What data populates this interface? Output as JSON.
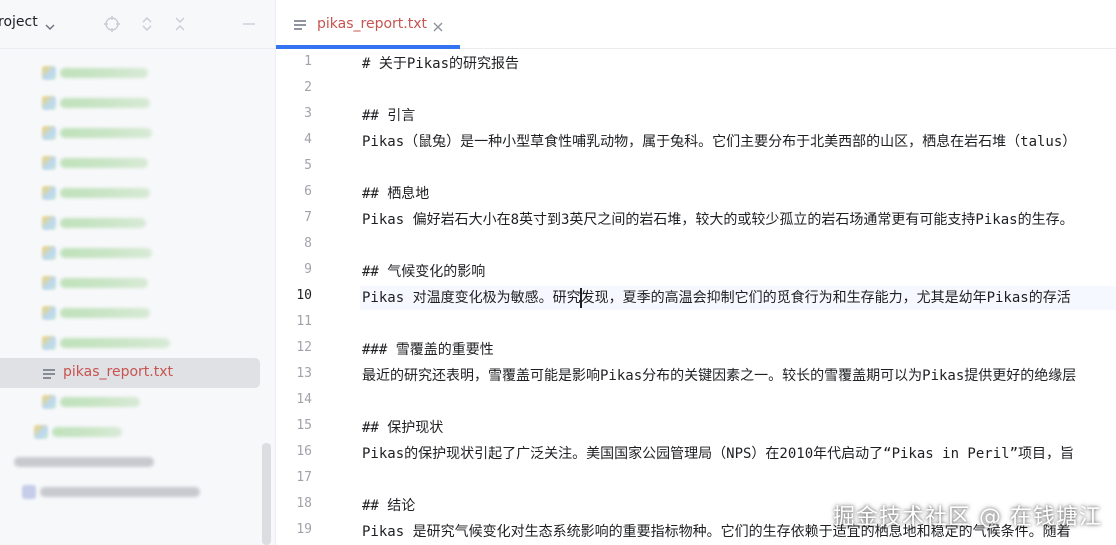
{
  "project": {
    "title": "roject",
    "selected_file": "pikas_report.txt"
  },
  "editor": {
    "tab_label": "pikas_report.txt",
    "lines": [
      {
        "num": "1",
        "text": "# 关于Pikas的研究报告"
      },
      {
        "num": "2",
        "text": ""
      },
      {
        "num": "3",
        "text": "## 引言"
      },
      {
        "num": "4",
        "text": "Pikas（鼠兔）是一种小型草食性哺乳动物，属于兔科。它们主要分布于北美西部的山区，栖息在岩石堆（talus）"
      },
      {
        "num": "5",
        "text": ""
      },
      {
        "num": "6",
        "text": "## 栖息地"
      },
      {
        "num": "7",
        "text": "Pikas 偏好岩石大小在8英寸到3英尺之间的岩石堆，较大的或较少孤立的岩石场通常更有可能支持Pikas的生存。"
      },
      {
        "num": "8",
        "text": ""
      },
      {
        "num": "9",
        "text": "## 气候变化的影响"
      },
      {
        "num": "10",
        "text": "Pikas 对温度变化极为敏感。研究发现，夏季的高温会抑制它们的觅食行为和生存能力，尤其是幼年Pikas的存活"
      },
      {
        "num": "11",
        "text": ""
      },
      {
        "num": "12",
        "text": "### 雪覆盖的重要性"
      },
      {
        "num": "13",
        "text": "最近的研究还表明，雪覆盖可能是影响Pikas分布的关键因素之一。较长的雪覆盖期可以为Pikas提供更好的绝缘层"
      },
      {
        "num": "14",
        "text": ""
      },
      {
        "num": "15",
        "text": "## 保护现状"
      },
      {
        "num": "16",
        "text": "Pikas的保护现状引起了广泛关注。美国国家公园管理局（NPS）在2010年代启动了“Pikas in Peril”项目，旨"
      },
      {
        "num": "17",
        "text": ""
      },
      {
        "num": "18",
        "text": "## 结论"
      },
      {
        "num": "19",
        "text": "Pikas 是研究气候变化对生态系统影响的重要指标物种。它们的生存依赖于适宜的栖息地和稳定的气候条件。随着"
      }
    ],
    "current_line": "10"
  },
  "watermark": "掘金技术社区 @ 在钱塘江",
  "colors": {
    "accent": "#3574f0",
    "file_label": "#c75450",
    "panel_bg": "#f7f8fa",
    "selection_bg": "#dfe1e5"
  },
  "icons": [
    "chevron-down-icon",
    "locate-icon",
    "expand-collapse-icon",
    "collapse-all-icon",
    "minimize-icon",
    "text-file-icon",
    "close-icon"
  ]
}
